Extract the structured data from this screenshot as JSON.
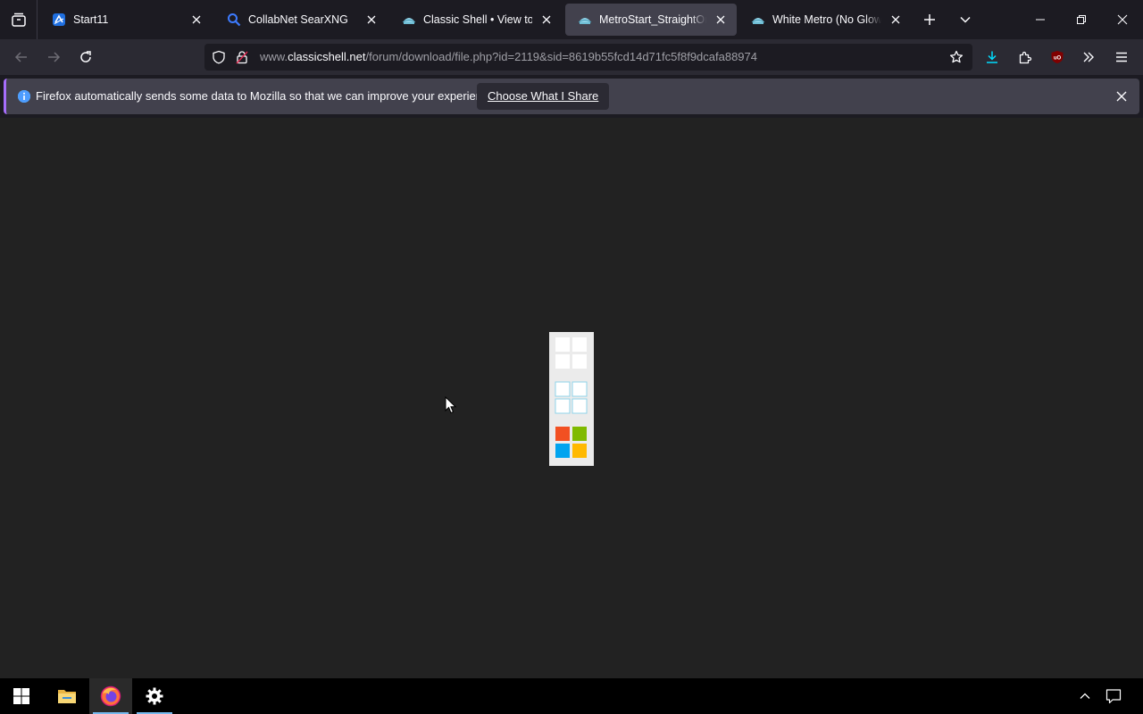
{
  "browser": {
    "tabs": [
      {
        "title": "Start11",
        "favicon": "start11-icon",
        "active": false
      },
      {
        "title": "CollabNet SearXNG",
        "favicon": "search-icon",
        "active": false
      },
      {
        "title": "Classic Shell • View topic",
        "favicon": "classic-shell-icon",
        "active": false
      },
      {
        "title": "MetroStart_StraightOn.png",
        "favicon": "classic-shell-icon",
        "active": true
      },
      {
        "title": "White Metro (No Glow On",
        "favicon": "classic-shell-icon",
        "active": false
      }
    ],
    "address_bar": {
      "url_prefix": "www.",
      "url_host": "classicshell.net",
      "url_path": "/forum/download/file.php?id=2119&sid=8619b55fcd14d71fc5f8f9dcafa88974"
    },
    "notification": {
      "message": "Firefox automatically sends some data to Mozilla so that we can improve your experience.",
      "button_label": "Choose What I Share"
    }
  },
  "colors": {
    "accent": "#a66efc",
    "download_blue": "#00ddff",
    "ublock_red": "#800000",
    "windows_blue": "#0078d4",
    "ms_red": "#f25022",
    "ms_green": "#7fba00",
    "ms_blue": "#00a4ef",
    "ms_yellow": "#ffb900"
  },
  "taskbar": {
    "items": [
      "windows-start-icon",
      "file-explorer-icon",
      "firefox-icon",
      "settings-gear-icon"
    ],
    "tray": [
      "chevron-up-icon",
      "notification-center-icon"
    ]
  }
}
